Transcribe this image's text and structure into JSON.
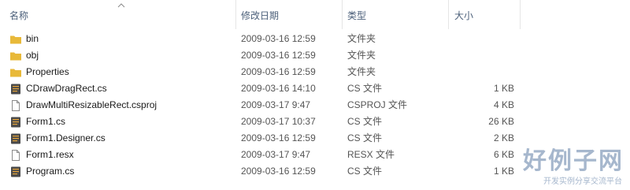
{
  "columns": {
    "name": "名称",
    "date": "修改日期",
    "type": "类型",
    "size": "大小"
  },
  "files": [
    {
      "name": "bin",
      "date": "2009-03-16 12:59",
      "type": "文件夹",
      "size": "",
      "icon": "folder-icon"
    },
    {
      "name": "obj",
      "date": "2009-03-16 12:59",
      "type": "文件夹",
      "size": "",
      "icon": "folder-icon"
    },
    {
      "name": "Properties",
      "date": "2009-03-16 12:59",
      "type": "文件夹",
      "size": "",
      "icon": "folder-icon"
    },
    {
      "name": "CDrawDragRect.cs",
      "date": "2009-03-16 14:10",
      "type": "CS 文件",
      "size": "1 KB",
      "icon": "cs-file-icon"
    },
    {
      "name": "DrawMultiResizableRect.csproj",
      "date": "2009-03-17 9:47",
      "type": "CSPROJ 文件",
      "size": "4 KB",
      "icon": "generic-file-icon"
    },
    {
      "name": "Form1.cs",
      "date": "2009-03-17 10:37",
      "type": "CS 文件",
      "size": "26 KB",
      "icon": "cs-file-icon"
    },
    {
      "name": "Form1.Designer.cs",
      "date": "2009-03-16 12:59",
      "type": "CS 文件",
      "size": "2 KB",
      "icon": "cs-file-icon"
    },
    {
      "name": "Form1.resx",
      "date": "2009-03-17 9:47",
      "type": "RESX 文件",
      "size": "6 KB",
      "icon": "generic-file-icon"
    },
    {
      "name": "Program.cs",
      "date": "2009-03-16 12:59",
      "type": "CS 文件",
      "size": "1 KB",
      "icon": "cs-file-icon"
    }
  ],
  "watermark": {
    "main": "好例子网",
    "sub": "开发实例分享交流平台"
  },
  "colors": {
    "folder": "#e8b83a",
    "cs_icon": "#4a4a4a",
    "header_text": "#4c607a",
    "watermark": "#a6b7cd"
  }
}
